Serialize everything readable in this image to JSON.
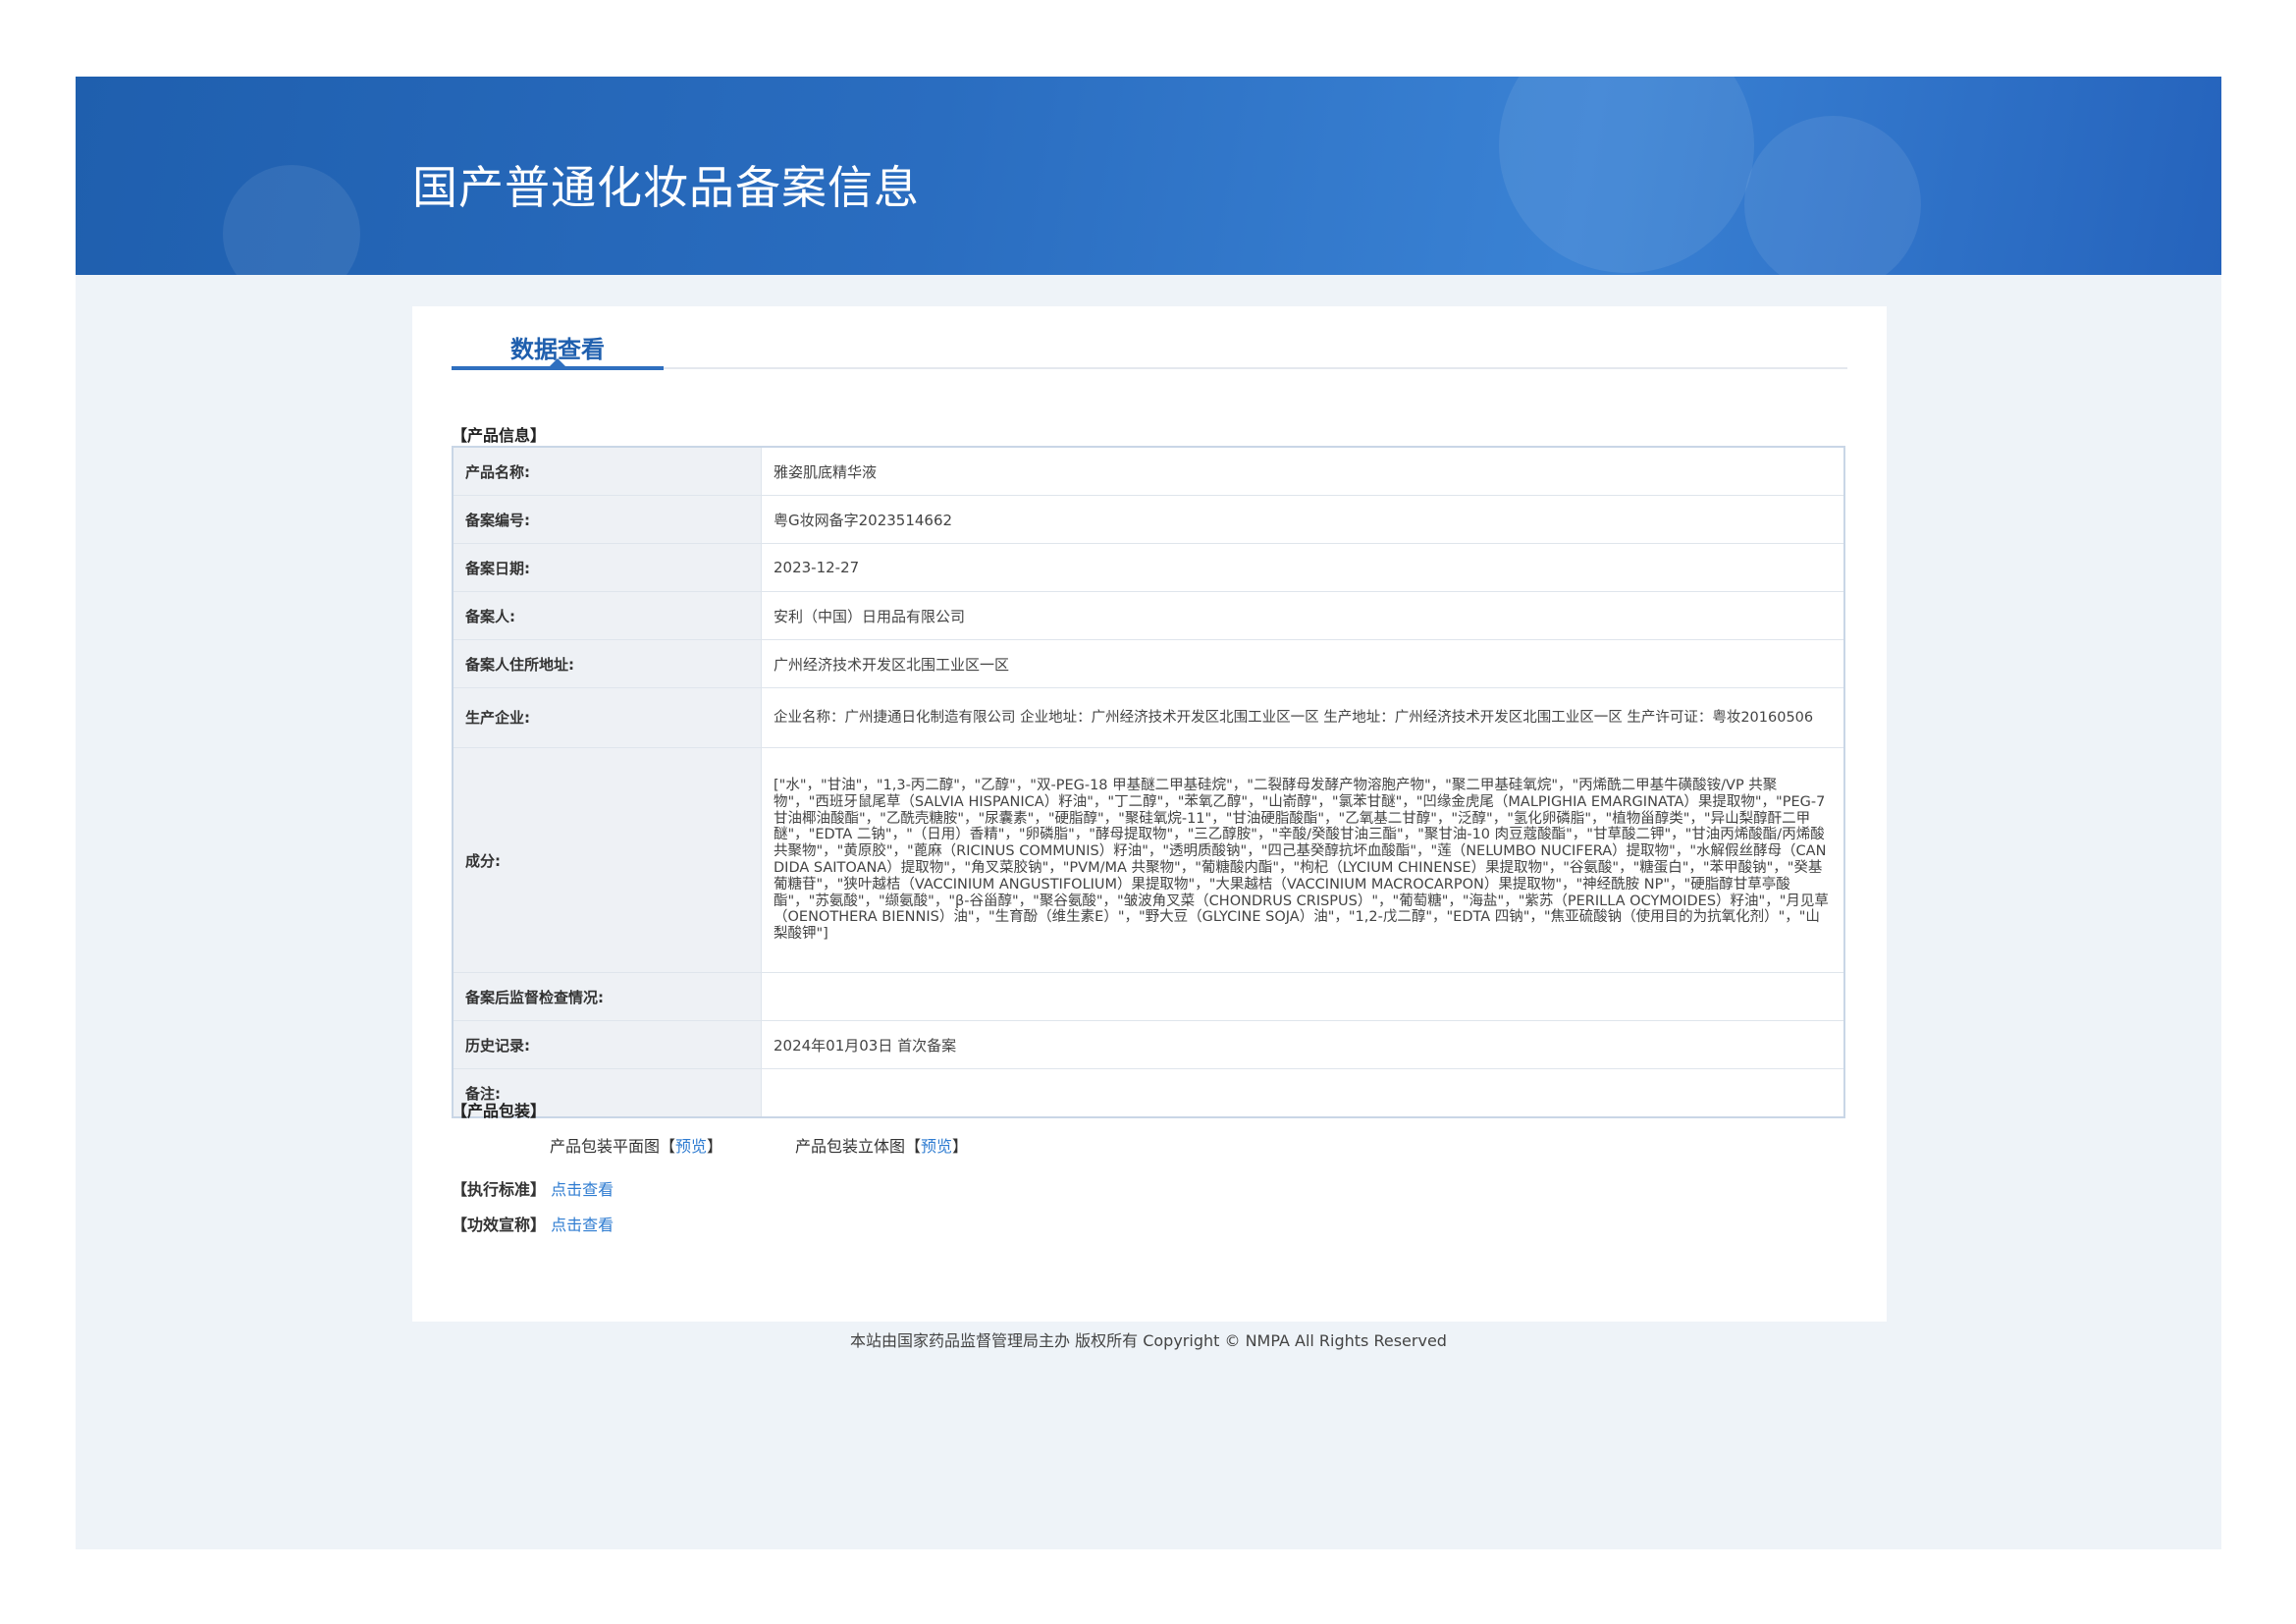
{
  "header": {
    "title": "国产普通化妆品备案信息"
  },
  "tabs": [
    {
      "label": "数据查看",
      "active": true
    }
  ],
  "product_info": {
    "section_label": "【产品信息】",
    "rows": [
      {
        "label": "产品名称:",
        "value": "雅姿肌底精华液"
      },
      {
        "label": "备案编号:",
        "value": "粤G妆网备字2023514662"
      },
      {
        "label": "备案日期:",
        "value": "2023-12-27"
      },
      {
        "label": "备案人:",
        "value": "安利（中国）日用品有限公司"
      },
      {
        "label": "备案人住所地址:",
        "value": "广州经济技术开发区北围工业区一区"
      },
      {
        "label": "生产企业:",
        "value": "企业名称：广州捷通日化制造有限公司 企业地址：广州经济技术开发区北围工业区一区 生产地址：广州经济技术开发区北围工业区一区 生产许可证：粤妆20160506"
      },
      {
        "label": "成分:",
        "value": "[\"水\"，\"甘油\"，\"1,3-丙二醇\"，\"乙醇\"，\"双-PEG-18 甲基醚二甲基硅烷\"，\"二裂酵母发酵产物溶胞产物\"，\"聚二甲基硅氧烷\"，\"丙烯酰二甲基牛磺酸铵/VP 共聚物\"，\"西班牙鼠尾草（SALVIA HISPANICA）籽油\"，\"丁二醇\"，\"苯氧乙醇\"，\"山嵛醇\"，\"氯苯甘醚\"，\"凹缘金虎尾（MALPIGHIA EMARGINATA）果提取物\"，\"PEG-7 甘油椰油酸酯\"，\"乙酰壳糖胺\"，\"尿囊素\"，\"硬脂醇\"，\"聚硅氧烷-11\"，\"甘油硬脂酸酯\"，\"乙氧基二甘醇\"，\"泛醇\"，\"氢化卵磷脂\"，\"植物甾醇类\"，\"异山梨醇酐二甲醚\"，\"EDTA 二钠\"，\"（日用）香精\"，\"卵磷脂\"，\"酵母提取物\"，\"三乙醇胺\"，\"辛酸/癸酸甘油三酯\"，\"聚甘油-10 肉豆蔻酸酯\"，\"甘草酸二钾\"，\"甘油丙烯酸酯/丙烯酸共聚物\"，\"黄原胶\"，\"蓖麻（RICINUS COMMUNIS）籽油\"，\"透明质酸钠\"，\"四己基癸醇抗坏血酸酯\"，\"莲（NELUMBO NUCIFERA）提取物\"，\"水解假丝酵母（CANDIDA SAITOANA）提取物\"，\"角叉菜胶钠\"，\"PVM/MA 共聚物\"，\"葡糖酸内酯\"，\"枸杞（LYCIUM CHINENSE）果提取物\"，\"谷氨酸\"，\"糖蛋白\"，\"苯甲酸钠\"，\"癸基葡糖苷\"，\"狭叶越桔（VACCINIUM ANGUSTIFOLIUM）果提取物\"，\"大果越桔（VACCINIUM MACROCARPON）果提取物\"，\"神经酰胺 NP\"，\"硬脂醇甘草亭酸酯\"，\"苏氨酸\"，\"缬氨酸\"，\"β-谷甾醇\"，\"聚谷氨酸\"，\"皱波角叉菜（CHONDRUS CRISPUS）\"，\"葡萄糖\"，\"海盐\"，\"紫苏（PERILLA OCYMOIDES）籽油\"，\"月见草（OENOTHERA BIENNIS）油\"，\"生育酚（维生素E）\"，\"野大豆（GLYCINE SOJA）油\"，\"1,2-戊二醇\"，\"EDTA 四钠\"，\"焦亚硫酸钠（使用目的为抗氧化剂）\"，\"山梨酸钾\"]"
      },
      {
        "label": "备案后监督检查情况:",
        "value": ""
      },
      {
        "label": "历史记录:",
        "value": "2024年01月03日 首次备案"
      },
      {
        "label": "备注:",
        "value": ""
      }
    ]
  },
  "packaging": {
    "section_label": "【产品包装】",
    "flat_label": "产品包装平面图",
    "solid_label": "产品包装立体图",
    "bracket_open": "【",
    "bracket_close": "】",
    "preview_link": "预览"
  },
  "standard": {
    "section_label": "【执行标准】",
    "link": "点击查看"
  },
  "claims": {
    "section_label": "【功效宣称】",
    "link": "点击查看"
  },
  "footer": {
    "text": "本站由国家药品监督管理局主办 版权所有 Copyright © NMPA All Rights Reserved"
  }
}
